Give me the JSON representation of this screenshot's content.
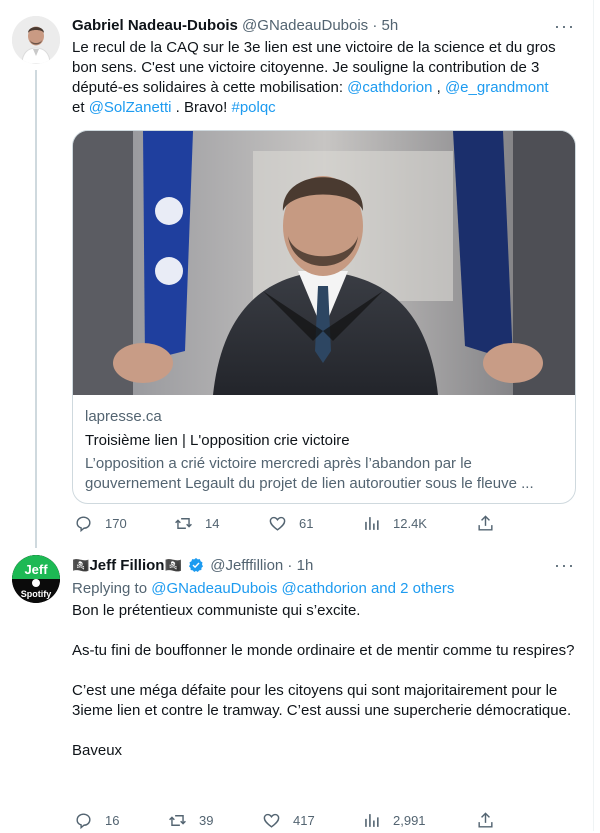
{
  "tweet1": {
    "author_name": "Gabriel Nadeau-Dubois",
    "handle": "@GNadeauDubois",
    "separator": " · ",
    "time": "5h",
    "text_parts": {
      "p1": "Le recul de la CAQ sur le 3e lien est une victoire de la science et du gros bon sens. C'est une victoire citoyenne. Je souligne la contribution de 3 député-es solidaires à cette mobilisation: ",
      "m1": "@cathdorion",
      "p2": " , ",
      "m2": "@e_grandmont",
      "p3": " et ",
      "m3": "@SolZanetti",
      "p4": " . Bravo! ",
      "h1": "#polqc"
    },
    "card": {
      "domain": "lapresse.ca",
      "title": "Troisième lien | L'opposition crie victoire",
      "description": "L’opposition a crié victoire mercredi après l’abandon par le gouvernement Legault du projet de lien autoroutier sous le fleuve ..."
    },
    "stats": {
      "replies": "170",
      "retweets": "14",
      "likes": "61",
      "views": "12.4K"
    }
  },
  "tweet2": {
    "author_prefix": "🏴‍☠️",
    "author_name": "Jeff Fillion",
    "author_suffix": "🏴‍☠️",
    "handle": "@Jefffillion",
    "separator": " · ",
    "time": "1h",
    "replying_label": "Replying to ",
    "replying_to": "@GNadeauDubois @cathdorion and 2 others",
    "paragraphs": [
      "Bon le prétentieux communiste qui s’excite.",
      "As-tu fini de bouffonner le monde ordinaire et de mentir comme tu respires?",
      "C’est une méga défaite pour les citoyens qui sont majoritairement pour le 3ieme lien et contre le tramway. C’est aussi une supercherie démocratique.",
      "Baveux"
    ],
    "stats": {
      "replies": "16",
      "retweets": "39",
      "likes": "417",
      "views": "2,991"
    },
    "avatar_text_top": "Jeff",
    "avatar_text_bottom": "Spotify"
  },
  "more_glyph": "···",
  "colors": {
    "link": "#1d9bf0",
    "muted": "#536471",
    "verified": "#1d9bf0"
  }
}
